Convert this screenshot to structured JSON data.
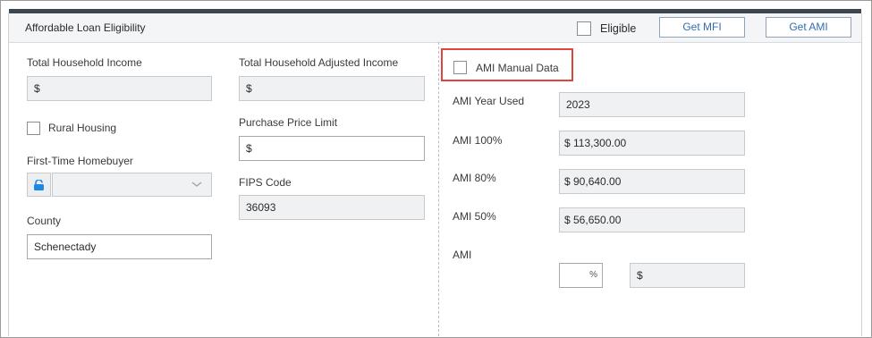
{
  "header": {
    "title": "Affordable Loan Eligibility",
    "eligible_label": "Eligible",
    "get_mfi_label": "Get MFI",
    "get_ami_label": "Get AMI"
  },
  "left": {
    "total_household_income_label": "Total Household Income",
    "total_household_income_value": "$",
    "rural_housing_label": "Rural Housing",
    "first_time_homebuyer_label": "First-Time Homebuyer",
    "county_label": "County",
    "county_value": "Schenectady"
  },
  "middle": {
    "total_household_adjusted_income_label": "Total Household Adjusted Income",
    "total_household_adjusted_income_value": "$",
    "purchase_price_limit_label": "Purchase Price Limit",
    "purchase_price_limit_value": "$",
    "fips_code_label": "FIPS Code",
    "fips_code_value": "36093"
  },
  "right": {
    "ami_manual_data_label": "AMI Manual Data",
    "ami_year_used_label": "AMI Year Used",
    "ami_year_used_value": "2023",
    "ami_100_label": "AMI 100%",
    "ami_100_value": "$ 113,300.00",
    "ami_80_label": "AMI 80%",
    "ami_80_value": "$ 90,640.00",
    "ami_50_label": "AMI 50%",
    "ami_50_value": "$ 56,650.00",
    "ami_label": "AMI",
    "ami_percent_symbol": "%",
    "ami_amount_value": "$"
  },
  "colors": {
    "accent": "#2f6db3",
    "highlight": "#e0453c",
    "lock": "#1e88e5"
  }
}
